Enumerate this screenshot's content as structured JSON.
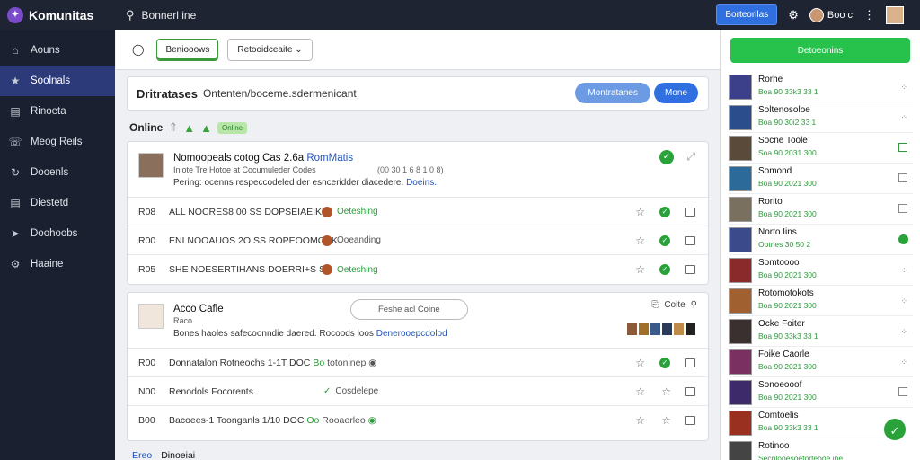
{
  "topbar": {
    "brand": "Komunitas",
    "search_text": "Bonnerl ine",
    "primary_button": "Borteorilas",
    "user_name": "Boo c"
  },
  "sidebar": {
    "items": [
      {
        "label": "Aouns",
        "icon": "home-icon",
        "glyph": "⌂"
      },
      {
        "label": "Soolnals",
        "icon": "star-icon",
        "glyph": "★",
        "active": true
      },
      {
        "label": "Rinoeta",
        "icon": "document-icon",
        "glyph": "▤"
      },
      {
        "label": "Meog Reils",
        "icon": "phone-icon",
        "glyph": "☏"
      },
      {
        "label": "Dooenls",
        "icon": "refresh-icon",
        "glyph": "↻"
      },
      {
        "label": "Diestetd",
        "icon": "list-icon",
        "glyph": "▤"
      },
      {
        "label": "Doohoobs",
        "icon": "send-icon",
        "glyph": "➤"
      },
      {
        "label": "Haaine",
        "icon": "settings-icon",
        "glyph": "⚙"
      }
    ]
  },
  "tabs": {
    "tab1": "Beniooows",
    "dropdown": "Retooidceaite"
  },
  "searchbox": {
    "label": "Dritratases",
    "value": "Ontenten/boceme.sdermenicant",
    "button1": "Montratanes",
    "button2": "Mone"
  },
  "online": {
    "label": "Online",
    "badge": "Online"
  },
  "card1": {
    "title": "Nomoopeals cotog Cas 2.6a",
    "title_link": "RomMatis",
    "sub": "Inlote Tre Hotoe at Cocumuleder Codes",
    "date": "(00 30 1 6 8 1 0 8)",
    "desc": "Pering: ocenns respeccodeled der esnceridder diacedere.",
    "desc_link": "Doeins.",
    "rows": [
      {
        "code": "R08",
        "name": "ALL NOCRES8 00 SS DOPSEIAEIKE",
        "status": "Oeteshing"
      },
      {
        "code": "R00",
        "name": "ENLNOOAUOS 2O SS ROPEOOMOSK",
        "status": "Ooeanding"
      },
      {
        "code": "R05",
        "name": "SHE NOESERTIHANS DOERRI+S SS",
        "status": "Oeteshing"
      }
    ]
  },
  "card2": {
    "title": "Acco Cafle",
    "sub": "Raco",
    "pill": "Feshe acl Coine",
    "actions": "Colte",
    "desc": "Bones haoles safecoonndie daered. Rocoods loos",
    "desc_link": "Denerooepcdolod",
    "rows": [
      {
        "code": "R00",
        "name": "Donnatalon Rotneochs 1-1T DOC",
        "tag": "Bo",
        "status": "totoninep"
      },
      {
        "code": "N00",
        "name": "Renodols Focorents",
        "status": "Cosdelepe"
      },
      {
        "code": "B00",
        "name": "Bacoees-1 Toonganls 1/10 DOC",
        "tag": "Oo",
        "status": "Rooaerleo"
      }
    ]
  },
  "bottom": {
    "link": "Ereo",
    "text": "Dinoeiai"
  },
  "rightpanel": {
    "button": "Detoeonins",
    "items": [
      {
        "name": "Rorhe",
        "meta": "Boa 90 33k3 33 1",
        "color": "#3c3f8a"
      },
      {
        "name": "Soltenosoloe",
        "meta": "Boa 90 30i2 33 1",
        "color": "#2c4d8c"
      },
      {
        "name": "Socne Toole",
        "meta": "Soa 90 2031 300",
        "color": "#5a4a3a"
      },
      {
        "name": "Somond",
        "meta": "Boa 90 2021 300",
        "color": "#2c6a9a"
      },
      {
        "name": "Rorito",
        "meta": "Boa 90 2021 300",
        "color": "#7a7060"
      },
      {
        "name": "Norto Iins",
        "meta": "Ootnes 30 50 2",
        "color": "#3a4a8a"
      },
      {
        "name": "Somtoooo",
        "meta": "Boa 90 2021 300",
        "color": "#8a2a2a"
      },
      {
        "name": "Rotomotokots",
        "meta": "Boa 90 2021 300",
        "color": "#a06030"
      },
      {
        "name": "Ocke Foiter",
        "meta": "Boa 90 33k3 33 1",
        "color": "#3a3030"
      },
      {
        "name": "Foike Caorle",
        "meta": "Boa 90 2021 300",
        "color": "#7a3060"
      },
      {
        "name": "Sonoeooof",
        "meta": "Boa 90 2021 300",
        "color": "#3c2a6a"
      },
      {
        "name": "Comtoelis",
        "meta": "Boa 90 33k3 33 1",
        "color": "#9a3020"
      },
      {
        "name": "Rotinoo",
        "meta": "Secnlooesoeforteooe ine",
        "color": "#444"
      }
    ]
  }
}
